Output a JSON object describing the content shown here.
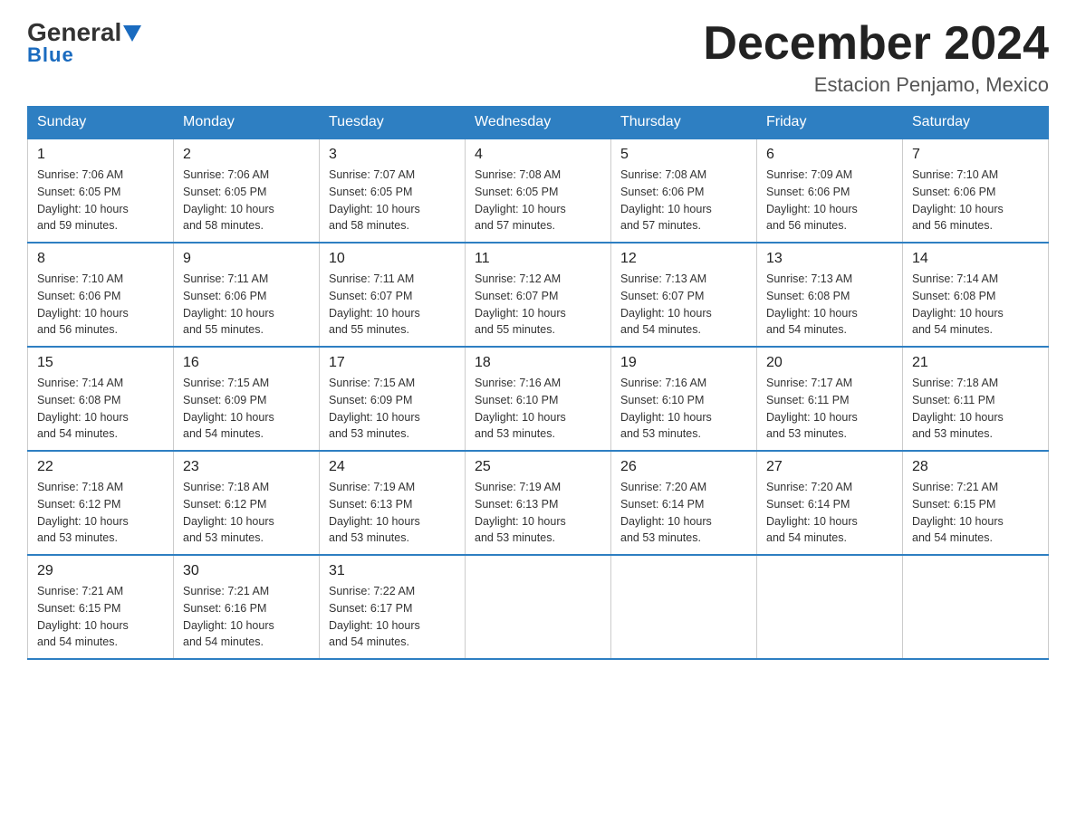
{
  "header": {
    "logo": {
      "general": "General",
      "blue": "Blue"
    },
    "title": "December 2024",
    "location": "Estacion Penjamo, Mexico"
  },
  "days_of_week": [
    "Sunday",
    "Monday",
    "Tuesday",
    "Wednesday",
    "Thursday",
    "Friday",
    "Saturday"
  ],
  "weeks": [
    [
      {
        "day": "1",
        "sunrise": "7:06 AM",
        "sunset": "6:05 PM",
        "daylight": "10 hours and 59 minutes."
      },
      {
        "day": "2",
        "sunrise": "7:06 AM",
        "sunset": "6:05 PM",
        "daylight": "10 hours and 58 minutes."
      },
      {
        "day": "3",
        "sunrise": "7:07 AM",
        "sunset": "6:05 PM",
        "daylight": "10 hours and 58 minutes."
      },
      {
        "day": "4",
        "sunrise": "7:08 AM",
        "sunset": "6:05 PM",
        "daylight": "10 hours and 57 minutes."
      },
      {
        "day": "5",
        "sunrise": "7:08 AM",
        "sunset": "6:06 PM",
        "daylight": "10 hours and 57 minutes."
      },
      {
        "day": "6",
        "sunrise": "7:09 AM",
        "sunset": "6:06 PM",
        "daylight": "10 hours and 56 minutes."
      },
      {
        "day": "7",
        "sunrise": "7:10 AM",
        "sunset": "6:06 PM",
        "daylight": "10 hours and 56 minutes."
      }
    ],
    [
      {
        "day": "8",
        "sunrise": "7:10 AM",
        "sunset": "6:06 PM",
        "daylight": "10 hours and 56 minutes."
      },
      {
        "day": "9",
        "sunrise": "7:11 AM",
        "sunset": "6:06 PM",
        "daylight": "10 hours and 55 minutes."
      },
      {
        "day": "10",
        "sunrise": "7:11 AM",
        "sunset": "6:07 PM",
        "daylight": "10 hours and 55 minutes."
      },
      {
        "day": "11",
        "sunrise": "7:12 AM",
        "sunset": "6:07 PM",
        "daylight": "10 hours and 55 minutes."
      },
      {
        "day": "12",
        "sunrise": "7:13 AM",
        "sunset": "6:07 PM",
        "daylight": "10 hours and 54 minutes."
      },
      {
        "day": "13",
        "sunrise": "7:13 AM",
        "sunset": "6:08 PM",
        "daylight": "10 hours and 54 minutes."
      },
      {
        "day": "14",
        "sunrise": "7:14 AM",
        "sunset": "6:08 PM",
        "daylight": "10 hours and 54 minutes."
      }
    ],
    [
      {
        "day": "15",
        "sunrise": "7:14 AM",
        "sunset": "6:08 PM",
        "daylight": "10 hours and 54 minutes."
      },
      {
        "day": "16",
        "sunrise": "7:15 AM",
        "sunset": "6:09 PM",
        "daylight": "10 hours and 54 minutes."
      },
      {
        "day": "17",
        "sunrise": "7:15 AM",
        "sunset": "6:09 PM",
        "daylight": "10 hours and 53 minutes."
      },
      {
        "day": "18",
        "sunrise": "7:16 AM",
        "sunset": "6:10 PM",
        "daylight": "10 hours and 53 minutes."
      },
      {
        "day": "19",
        "sunrise": "7:16 AM",
        "sunset": "6:10 PM",
        "daylight": "10 hours and 53 minutes."
      },
      {
        "day": "20",
        "sunrise": "7:17 AM",
        "sunset": "6:11 PM",
        "daylight": "10 hours and 53 minutes."
      },
      {
        "day": "21",
        "sunrise": "7:18 AM",
        "sunset": "6:11 PM",
        "daylight": "10 hours and 53 minutes."
      }
    ],
    [
      {
        "day": "22",
        "sunrise": "7:18 AM",
        "sunset": "6:12 PM",
        "daylight": "10 hours and 53 minutes."
      },
      {
        "day": "23",
        "sunrise": "7:18 AM",
        "sunset": "6:12 PM",
        "daylight": "10 hours and 53 minutes."
      },
      {
        "day": "24",
        "sunrise": "7:19 AM",
        "sunset": "6:13 PM",
        "daylight": "10 hours and 53 minutes."
      },
      {
        "day": "25",
        "sunrise": "7:19 AM",
        "sunset": "6:13 PM",
        "daylight": "10 hours and 53 minutes."
      },
      {
        "day": "26",
        "sunrise": "7:20 AM",
        "sunset": "6:14 PM",
        "daylight": "10 hours and 53 minutes."
      },
      {
        "day": "27",
        "sunrise": "7:20 AM",
        "sunset": "6:14 PM",
        "daylight": "10 hours and 54 minutes."
      },
      {
        "day": "28",
        "sunrise": "7:21 AM",
        "sunset": "6:15 PM",
        "daylight": "10 hours and 54 minutes."
      }
    ],
    [
      {
        "day": "29",
        "sunrise": "7:21 AM",
        "sunset": "6:15 PM",
        "daylight": "10 hours and 54 minutes."
      },
      {
        "day": "30",
        "sunrise": "7:21 AM",
        "sunset": "6:16 PM",
        "daylight": "10 hours and 54 minutes."
      },
      {
        "day": "31",
        "sunrise": "7:22 AM",
        "sunset": "6:17 PM",
        "daylight": "10 hours and 54 minutes."
      },
      null,
      null,
      null,
      null
    ]
  ],
  "labels": {
    "sunrise": "Sunrise:",
    "sunset": "Sunset:",
    "daylight": "Daylight:"
  }
}
